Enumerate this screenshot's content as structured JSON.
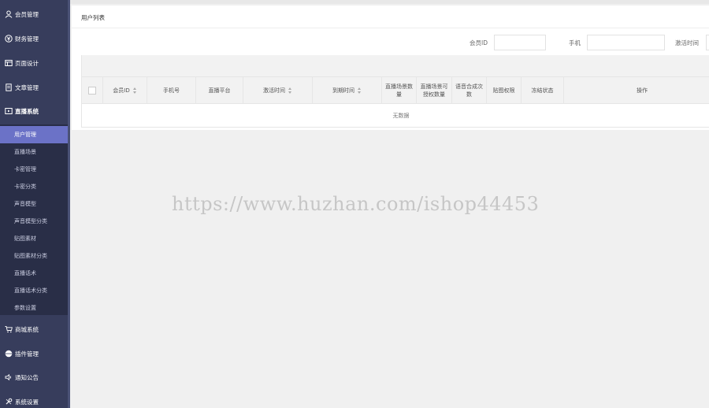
{
  "sidebar": {
    "items": [
      {
        "label": "会员管理",
        "icon": "user-icon"
      },
      {
        "label": "财务管理",
        "icon": "money-icon"
      },
      {
        "label": "页面设计",
        "icon": "layout-icon"
      },
      {
        "label": "文章管理",
        "icon": "document-icon"
      },
      {
        "label": "直播系统",
        "icon": "play-icon"
      },
      {
        "label": "商城系统",
        "icon": "cart-icon"
      },
      {
        "label": "插件管理",
        "icon": "plugin-icon"
      },
      {
        "label": "通知公告",
        "icon": "speaker-icon"
      },
      {
        "label": "系统设置",
        "icon": "settings-icon"
      }
    ],
    "submenu": [
      "用户管理",
      "直播场景",
      "卡密管理",
      "卡密分类",
      "声音模型",
      "声音模型分类",
      "贴图素材",
      "贴图素材分类",
      "直播话术",
      "直播话术分类",
      "参数设置"
    ],
    "active_submenu": "用户管理"
  },
  "main": {
    "panel_title": "用户列表",
    "filters": {
      "member_id_label": "会员ID",
      "member_id_value": "",
      "phone_label": "手机",
      "phone_value": "",
      "activate_time_label": "激活时间"
    },
    "table": {
      "columns": [
        {
          "label": "",
          "type": "checkbox"
        },
        {
          "label": "会员ID",
          "sortable": true
        },
        {
          "label": "手机号",
          "sortable": false
        },
        {
          "label": "直播平台",
          "sortable": false
        },
        {
          "label": "激活时间",
          "sortable": true
        },
        {
          "label": "到期时间",
          "sortable": true
        },
        {
          "label": "直播场景数量",
          "sortable": false
        },
        {
          "label": "直播场景可授权数量",
          "sortable": false
        },
        {
          "label": "语音合成次数",
          "sortable": false
        },
        {
          "label": "贴图权限",
          "sortable": false
        },
        {
          "label": "冻结状态",
          "sortable": false
        },
        {
          "label": "操作",
          "sortable": false
        }
      ],
      "empty_text": "无数据"
    }
  },
  "watermark": "https://www.huzhan.com/ishop44453"
}
